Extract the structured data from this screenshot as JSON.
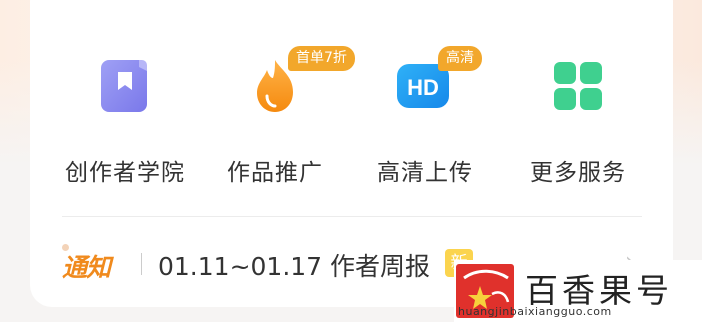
{
  "colors": {
    "accent_orange": "#f08a1d",
    "badge_orange": "#f2a72b",
    "new_badge_yellow": "#fbd44e",
    "academy_purple": "#8e8cf0",
    "hd_blue": "#1f9bf0",
    "more_green": "#3fcf8e"
  },
  "services": [
    {
      "icon": "book-bookmark-icon",
      "label": "创作者学院",
      "badge": ""
    },
    {
      "icon": "flame-icon",
      "label": "作品推广",
      "badge": "首单7折"
    },
    {
      "icon": "hd-icon",
      "label": "高清上传",
      "badge": "高清"
    },
    {
      "icon": "grid-icon",
      "label": "更多服务",
      "badge": ""
    }
  ],
  "notice": {
    "tag": "通知",
    "text": "01.11~01.17 作者周报",
    "new_badge": "新"
  },
  "watermark": {
    "text": "百香果号",
    "url": "huangjinbaixiangguo.com"
  }
}
